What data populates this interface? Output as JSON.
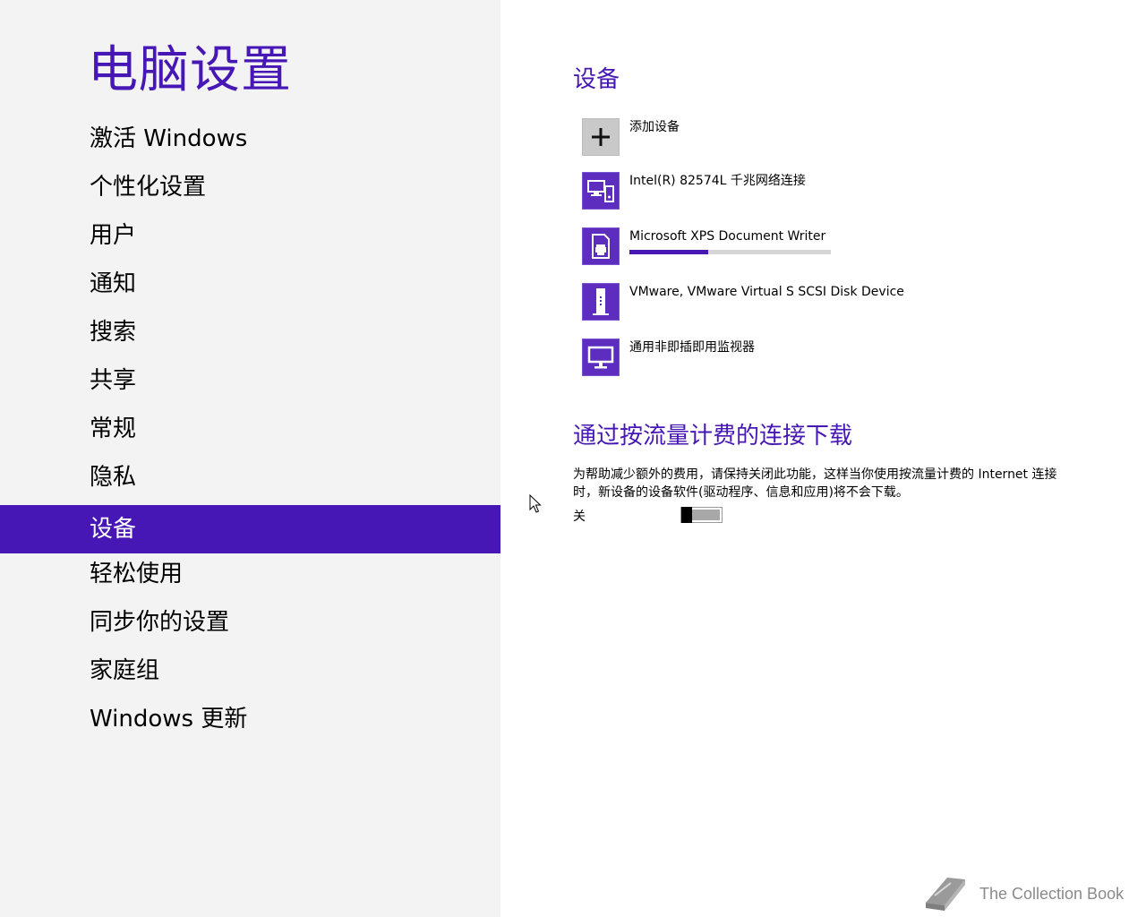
{
  "app": {
    "title": "电脑设置"
  },
  "sidebar": {
    "items": [
      {
        "label": "激活 Windows"
      },
      {
        "label": "个性化设置"
      },
      {
        "label": "用户"
      },
      {
        "label": "通知"
      },
      {
        "label": "搜索"
      },
      {
        "label": "共享"
      },
      {
        "label": "常规"
      },
      {
        "label": "隐私"
      },
      {
        "label": "设备",
        "selected": true
      },
      {
        "label": "轻松使用"
      },
      {
        "label": "同步你的设置"
      },
      {
        "label": "家庭组"
      },
      {
        "label": "Windows 更新"
      }
    ]
  },
  "main": {
    "devices_section": {
      "title": "设备",
      "add_label": "添加设备",
      "add_icon": "plus-icon",
      "devices": [
        {
          "name": "Intel(R) 82574L 千兆网络连接",
          "icon": "network-adapter-icon"
        },
        {
          "name": "Microsoft XPS Document Writer",
          "icon": "printer-icon",
          "progress": 0.39
        },
        {
          "name": "VMware, VMware Virtual S SCSI Disk Device",
          "icon": "disk-drive-icon"
        },
        {
          "name": "通用非即插即用监视器",
          "icon": "monitor-icon"
        }
      ]
    },
    "metered_section": {
      "title": "通过按流量计费的连接下载",
      "description": "为帮助减少额外的费用，请保持关闭此功能，这样当你使用按流量计费的 Internet 连接时，新设备的设备软件(驱动程序、信息和应用)将不会下载。",
      "toggle_label": "关",
      "toggle_on": false
    }
  },
  "watermark": {
    "text": "The Collection Book",
    "icon": "book-icon"
  },
  "colors": {
    "accent": "#4617b4",
    "sidebar_bg": "#f3f3f3",
    "tile": "#5c2dbf"
  }
}
